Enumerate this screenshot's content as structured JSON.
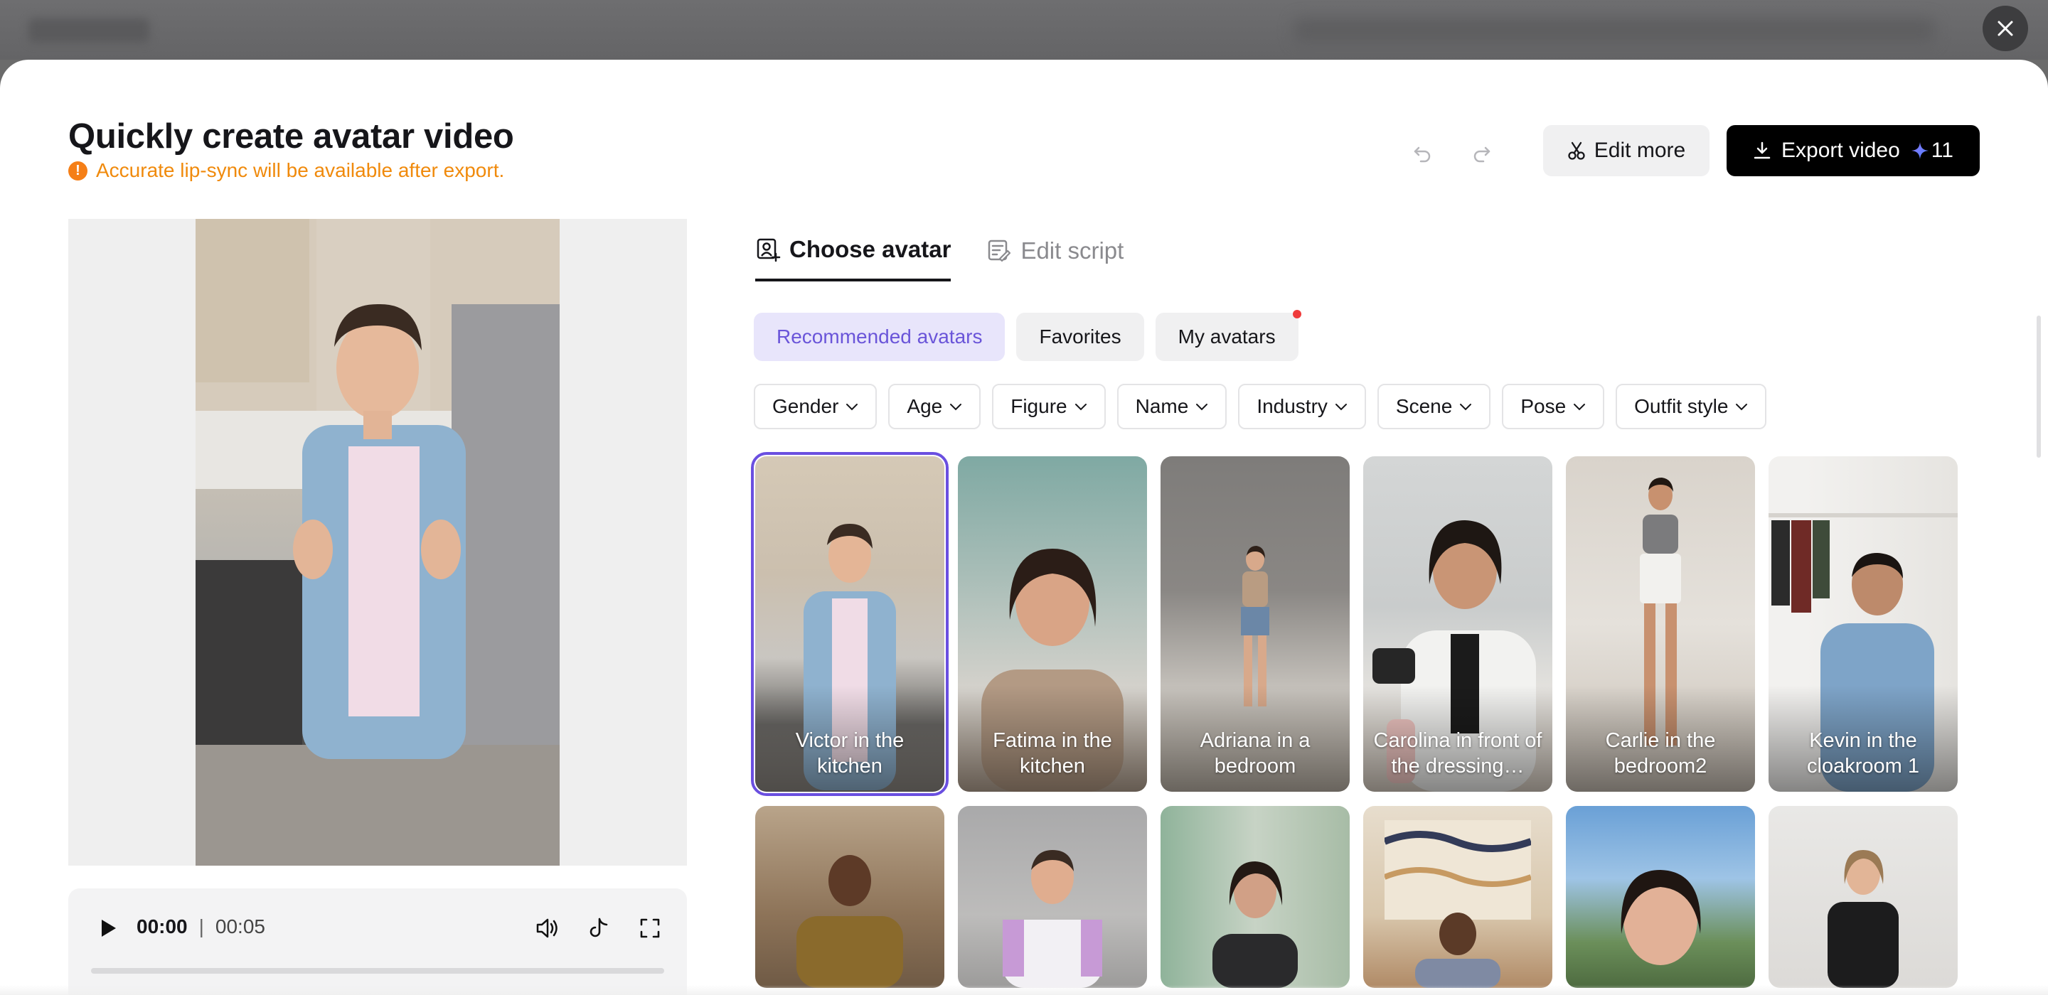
{
  "header": {
    "title": "Quickly create avatar video",
    "notice": "Accurate lip-sync will be available after export.",
    "notice_icon": "!",
    "edit_more": "Edit more",
    "export_video": "Export video",
    "export_credits": "11"
  },
  "player": {
    "current_time": "00:00",
    "separator": "|",
    "duration": "00:05",
    "progress": 0
  },
  "tabs": [
    {
      "label": "Choose avatar",
      "active": true
    },
    {
      "label": "Edit script",
      "active": false
    }
  ],
  "pills": [
    {
      "label": "Recommended avatars",
      "active": true
    },
    {
      "label": "Favorites",
      "active": false
    },
    {
      "label": "My avatars",
      "active": false,
      "has_notification_dot": true
    }
  ],
  "filters": [
    "Gender",
    "Age",
    "Figure",
    "Name",
    "Industry",
    "Scene",
    "Pose",
    "Outfit style"
  ],
  "avatars_row1": [
    {
      "label": "Victor in the kitchen",
      "selected": true
    },
    {
      "label": "Fatima in the kitchen"
    },
    {
      "label": "Adriana in a bedroom"
    },
    {
      "label": "Carolina in front of the dressing…"
    },
    {
      "label": "Carlie in the bedroom2"
    },
    {
      "label": "Kevin in the cloakroom 1"
    }
  ],
  "colors": {
    "accent": "#6a4fe0",
    "pill_active_bg": "#e8e5fb",
    "pill_active_text": "#6a55d9",
    "notice": "#f08a0c",
    "notification_dot": "#ef3b3b",
    "export_bg": "#000000"
  },
  "icons": {
    "close": "close-icon",
    "undo": "undo-icon",
    "redo": "redo-icon",
    "edit_more": "scissors-icon",
    "export": "download-icon",
    "credits": "sparkle-icon",
    "tab_avatar": "avatar-portrait-icon",
    "tab_script": "script-edit-icon",
    "play": "play-icon",
    "volume": "volume-icon",
    "tiktok": "tiktok-icon",
    "fullscreen": "fullscreen-icon",
    "chevron": "chevron-down-icon"
  }
}
